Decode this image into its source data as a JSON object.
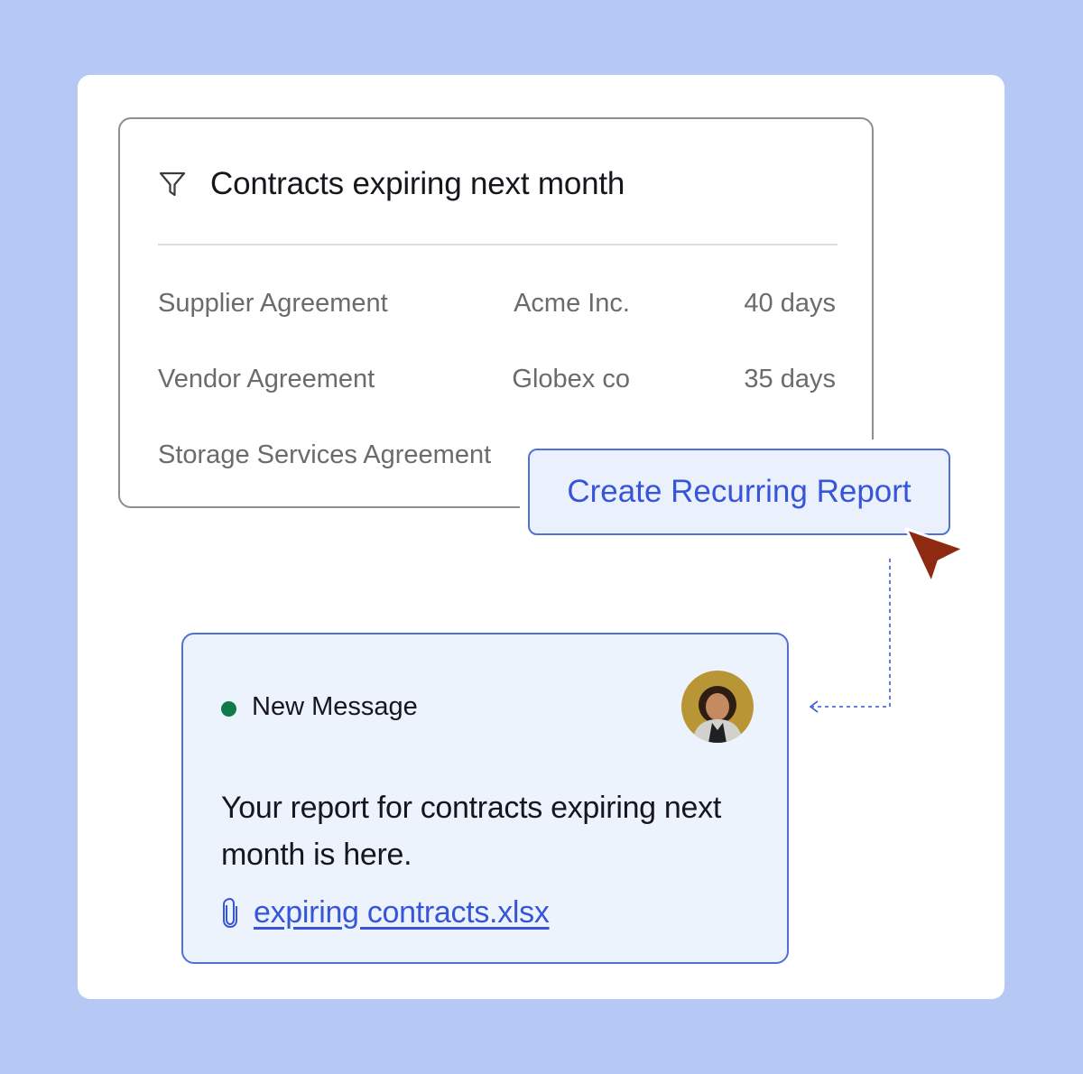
{
  "contracts_panel": {
    "filter_icon": "filter-funnel-icon",
    "title": "Contracts expiring next month",
    "rows": [
      {
        "name": "Supplier Agreement",
        "party": "Acme Inc.",
        "days": "40 days"
      },
      {
        "name": "Vendor Agreement",
        "party": "Globex co",
        "days": "35 days"
      },
      {
        "name": "Storage Services Agreement"
      }
    ]
  },
  "action": {
    "button_label": "Create Recurring Report",
    "cursor_icon": "mouse-pointer-icon"
  },
  "message": {
    "status": "New Message",
    "status_color": "#0f7a46",
    "avatar_icon": "user-avatar",
    "body": "Your report for contracts expiring next month is here.",
    "attachment_icon": "paperclip-icon",
    "attachment_name": "expiring contracts.xlsx"
  },
  "colors": {
    "background": "#b6c8f4",
    "accent": "#3755d8",
    "cursor": "#8e2a12"
  }
}
